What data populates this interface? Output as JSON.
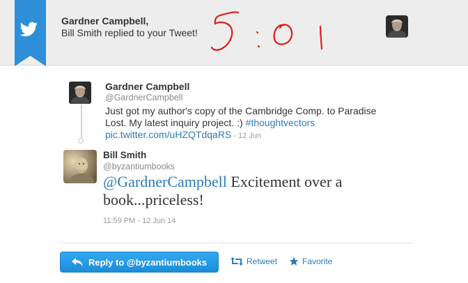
{
  "header": {
    "name": "Gardner Campbell,",
    "message": "Bill Smith replied to your Tweet!",
    "handwritten_note": "5:01",
    "bird_icon": "twitter-bird-icon"
  },
  "tweet_original": {
    "name": "Gardner Campbell",
    "handle": "@GardnerCampbell",
    "text_part1": "Just got my author's copy of the Cambridge Comp. to Paradise Lost. My latest inquiry project. :) ",
    "hashtag": "#thoughtvectors",
    "link": "pic.twitter.com/uHZQTdqaRS",
    "time": " - 12 Jun"
  },
  "tweet_reply": {
    "name": "Bill Smith",
    "handle": "@byzantiumbooks",
    "mention": "@GardnerCampbell",
    "text": " Excitement over a book...priceless!",
    "time": "11:59 PM - 12 Jun 14"
  },
  "actions": {
    "reply_label": "Reply to @byzantiumbooks",
    "retweet_label": "Retweet",
    "favorite_label": "Favorite"
  },
  "colors": {
    "accent": "#2b7bb9",
    "button": "#1b8dd9",
    "ribbon": "#2f8ed8",
    "scribble": "#e31b1b"
  }
}
